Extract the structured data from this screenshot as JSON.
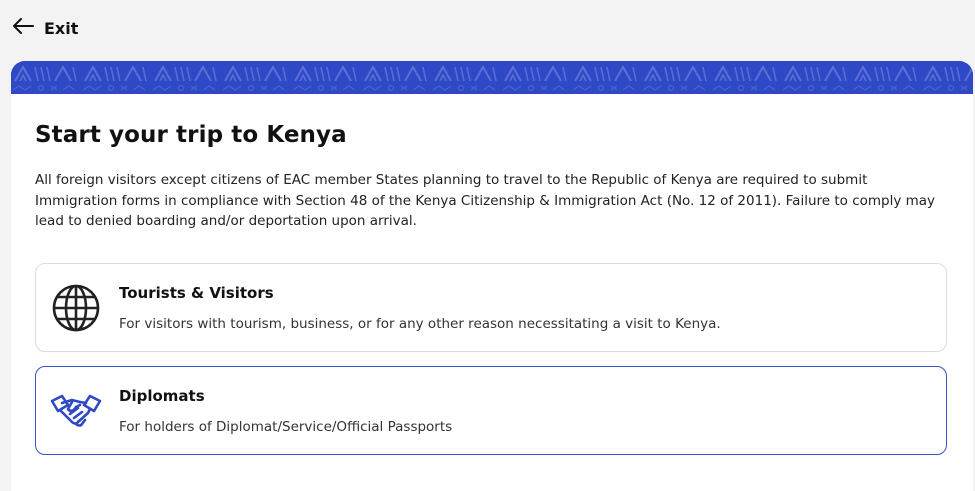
{
  "header": {
    "exit_label": "Exit",
    "exit_icon": "arrow-left-icon"
  },
  "banner": {
    "pattern_color": "#2f48c6"
  },
  "main": {
    "title": "Start your trip to Kenya",
    "intro": "All foreign visitors except citizens of EAC member States planning to travel to the Republic of Kenya are required to submit Immigration forms in compliance with Section 48 of the Kenya Citizenship & Immigration Act (No. 12 of 2011). Failure to comply may lead to denied boarding and/or deportation upon arrival."
  },
  "options": [
    {
      "title": "Tourists & Visitors",
      "description": "For visitors with tourism, business, or for any other reason necessitating a visit to Kenya.",
      "icon": "globe-icon",
      "selected": false
    },
    {
      "title": "Diplomats",
      "description": "For holders of Diplomat/Service/Official Passports",
      "icon": "handshake-icon",
      "selected": true
    }
  ],
  "colors": {
    "accent": "#2f48c6",
    "selected_border": "#3555c8",
    "page_bg": "#f3f3f3"
  }
}
